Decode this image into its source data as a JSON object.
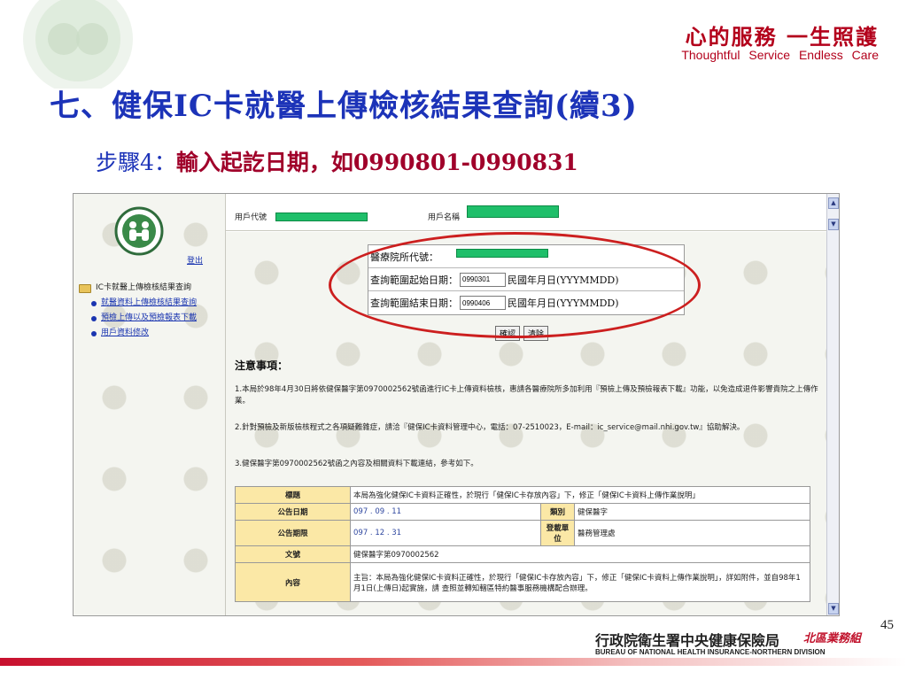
{
  "slide": {
    "slogan_cn": "心的服務  一生照護",
    "slogan_en": "Thoughtful  Service  Endless  Care",
    "title": "七、健保IC卡就醫上傳檢核結果查詢(續3)",
    "step_label": "步驟4：",
    "step_text": "輸入起訖日期，如0990801-0990831",
    "page_number": "45",
    "bureau_cn": "行政院衛生署中央健康保險局",
    "bureau_division": "北區業務組",
    "bureau_en": "BUREAU OF NATIONAL HEALTH INSURANCE-NORTHERN DIVISION"
  },
  "colors": {
    "title_blue": "#1c33b8",
    "accent_red": "#b3001b",
    "highlight_ellipse": "#cc1f1f",
    "redaction_green": "#1fbf6a",
    "table_header": "#fbe8a6"
  },
  "nav": {
    "logout": "登出",
    "root": "IC卡就醫上傳檢核結果查詢",
    "items": [
      "就醫資料上傳檢核結果查詢",
      "預檢上傳以及預檢報表下載",
      "用戶資料修改"
    ]
  },
  "header": {
    "user_id_label": "用戶代號",
    "user_name_label": "用戶名稱"
  },
  "form": {
    "hospital_code_label": "醫療院所代號：",
    "start_label": "查詢範圍起始日期：",
    "start_value": "0990301",
    "end_label": "查詢範圍結束日期：",
    "end_value": "0990406",
    "date_hint": "民國年月日(YYYMMDD)",
    "confirm": "確認",
    "clear": "清除"
  },
  "notes": {
    "title": "注意事項：",
    "items": [
      "1.本局於98年4月30日將依健保醫字第0970002562號函進行IC卡上傳資料檢核，惠請各醫療院所多加利用『預檢上傳及預檢報表下載』功能，以免造成退件影響貴院之上傳作業。",
      "2.針對預檢及新版檢核程式之各項疑難雜症，請洽『健保IC卡資料管理中心，電話：07-2510023，E-mail：ic_service@mail.nhi.gov.tw』協助解決。",
      "3.健保醫字第0970002562號函之內容及相關資料下載連結，參考如下。"
    ]
  },
  "bulletin": {
    "subject_label": "標題",
    "subject_value": "本局為強化健保IC卡資料正確性，於現行「健保IC卡存放內容」下，修正「健保IC卡資料上傳作業說明」",
    "date_label": "公告日期",
    "date_value": "097 . 09 . 11",
    "category_label": "類別",
    "category_value": "健保醫字",
    "period_label": "公告期限",
    "period_value": "097 . 12 . 31",
    "unit_label": "登載單位",
    "unit_value": "醫務管理處",
    "doc_label": "文號",
    "doc_value": "健保醫字第0970002562",
    "content_label": "內容",
    "content_value": "主旨：本局為強化健保IC卡資料正確性，於現行「健保IC卡存放內容」下，修正「健保IC卡資料上傳作業說明」，詳如附件，並自98年1月1日(上傳日)起實施，請  查照並轉知轄區特約醫事服務機構配合辦理。"
  },
  "scrollbar": {
    "up": "▲",
    "down": "▼"
  }
}
